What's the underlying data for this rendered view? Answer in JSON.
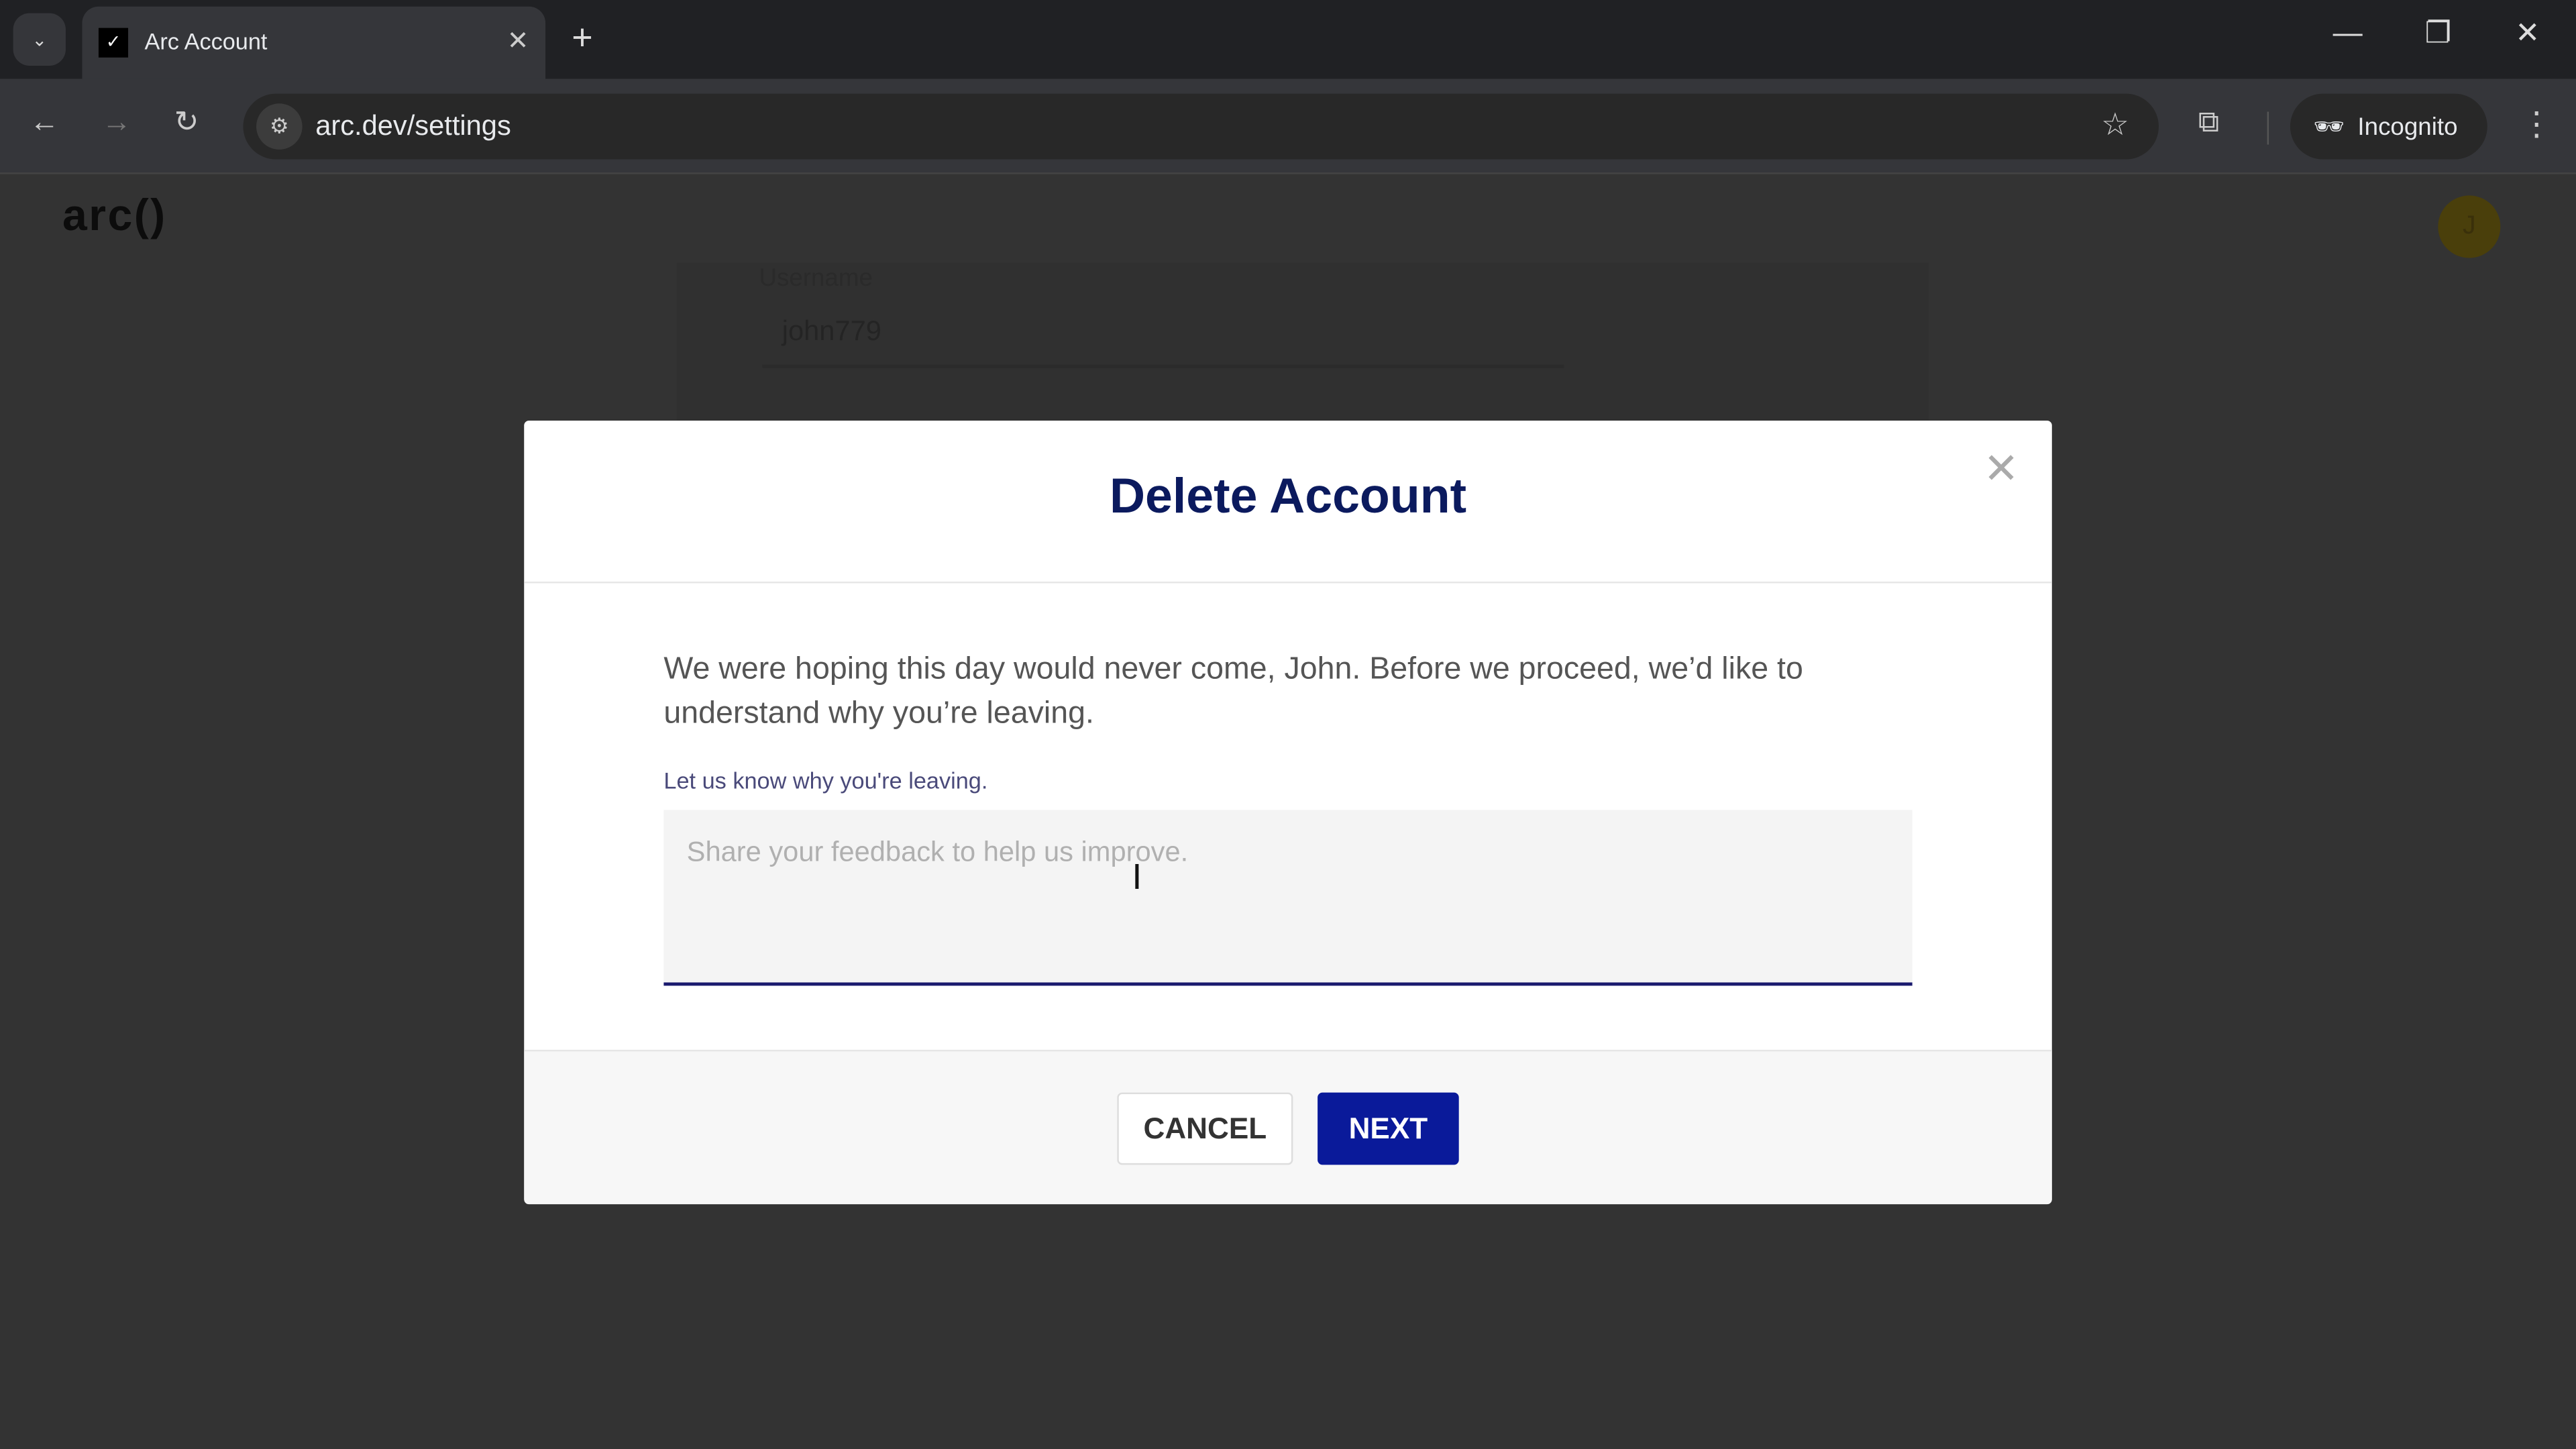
{
  "browser": {
    "tab_title": "Arc Account",
    "url": "arc.dev/settings",
    "incognito_label": "Incognito"
  },
  "page": {
    "logo": "arc()",
    "avatar_initial": "J",
    "username_label": "Username",
    "username_value": "john779"
  },
  "modal": {
    "title": "Delete Account",
    "intro": "We were hoping this day would never come, John. Before we proceed, we’d like to understand why you’re leaving.",
    "feedback_label": "Let us know why you're leaving.",
    "feedback_placeholder": "Share your feedback to help us improve.",
    "feedback_value": "",
    "cancel_label": "CANCEL",
    "next_label": "NEXT"
  },
  "colors": {
    "accent": "#0a1a9a",
    "title": "#0b1a5e"
  }
}
